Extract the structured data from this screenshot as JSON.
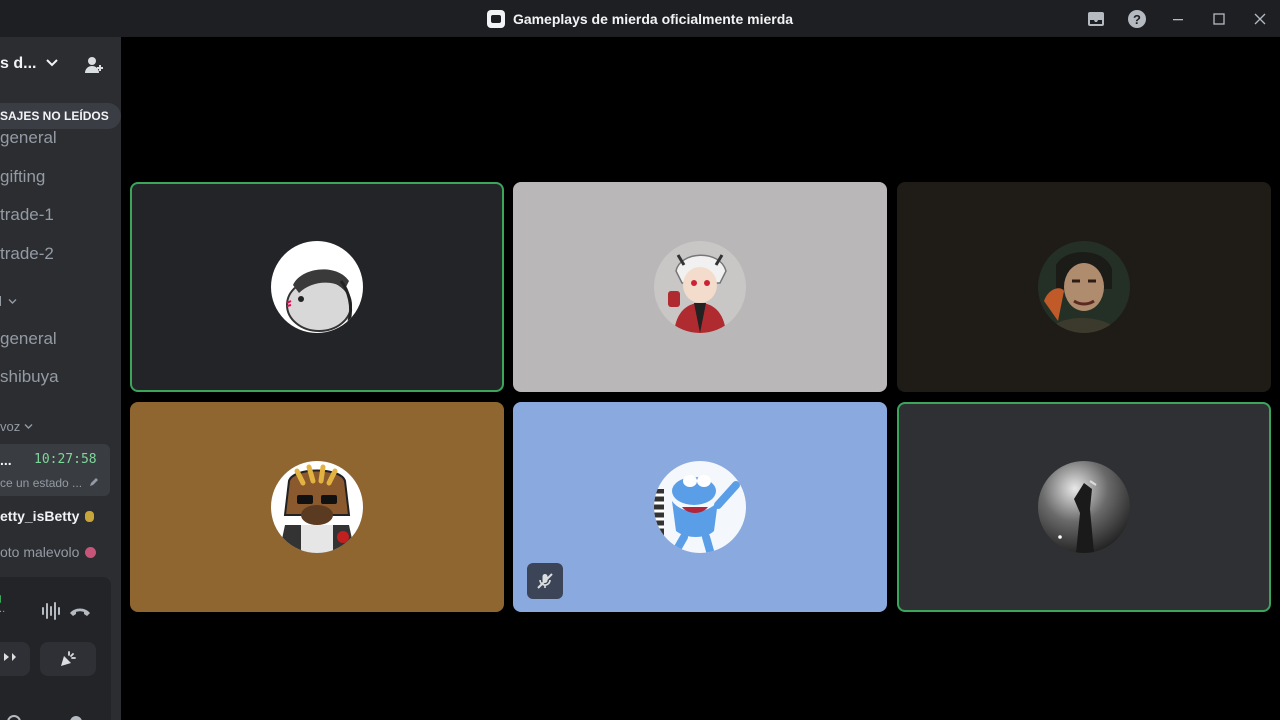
{
  "window": {
    "title": "Gameplays de mierda oficialmente mierda"
  },
  "sidebar": {
    "server_name": "s d...",
    "unread_label": "SAJES NO LEÍDOS",
    "channels": [
      {
        "label": "general"
      },
      {
        "label": "gifting"
      },
      {
        "label": "trade-1"
      },
      {
        "label": "trade-2"
      }
    ],
    "category_1": "",
    "channels_2": [
      {
        "label": "general"
      },
      {
        "label": "shibuya"
      }
    ],
    "voice_category": "voz",
    "voice_card": {
      "name": "...",
      "time": "10:27:58",
      "status": "ce un estado ..."
    },
    "members": [
      {
        "name": "etty_isBetty",
        "color": "#f2f3f5",
        "dot_color": "#c7a53a"
      },
      {
        "name": "oto malevolo",
        "color": "#949ba4",
        "dot_color": "#c7557a"
      }
    ],
    "voice_panel": {
      "status_dot": "..."
    }
  },
  "tiles": [
    {
      "bg": "#232428",
      "speaking": true,
      "muted": false,
      "avatar": "hamster-avatar"
    },
    {
      "bg": "#b9b7b8",
      "speaking": false,
      "muted": false,
      "avatar": "anime-avatar"
    },
    {
      "bg": "#1f1b16",
      "speaking": false,
      "muted": false,
      "avatar": "portrait-avatar"
    },
    {
      "bg": "#8f6530",
      "speaking": false,
      "muted": false,
      "avatar": "dog-avatar"
    },
    {
      "bg": "#8aa9de",
      "speaking": false,
      "muted": true,
      "avatar": "frog-avatar"
    },
    {
      "bg": "#2f3034",
      "speaking": true,
      "muted": false,
      "avatar": "dark-avatar"
    }
  ],
  "colors": {
    "speaking_border": "#3ba55c",
    "background": "#000000",
    "sidebar": "#2b2d31",
    "titlebar": "#1e1f22"
  }
}
